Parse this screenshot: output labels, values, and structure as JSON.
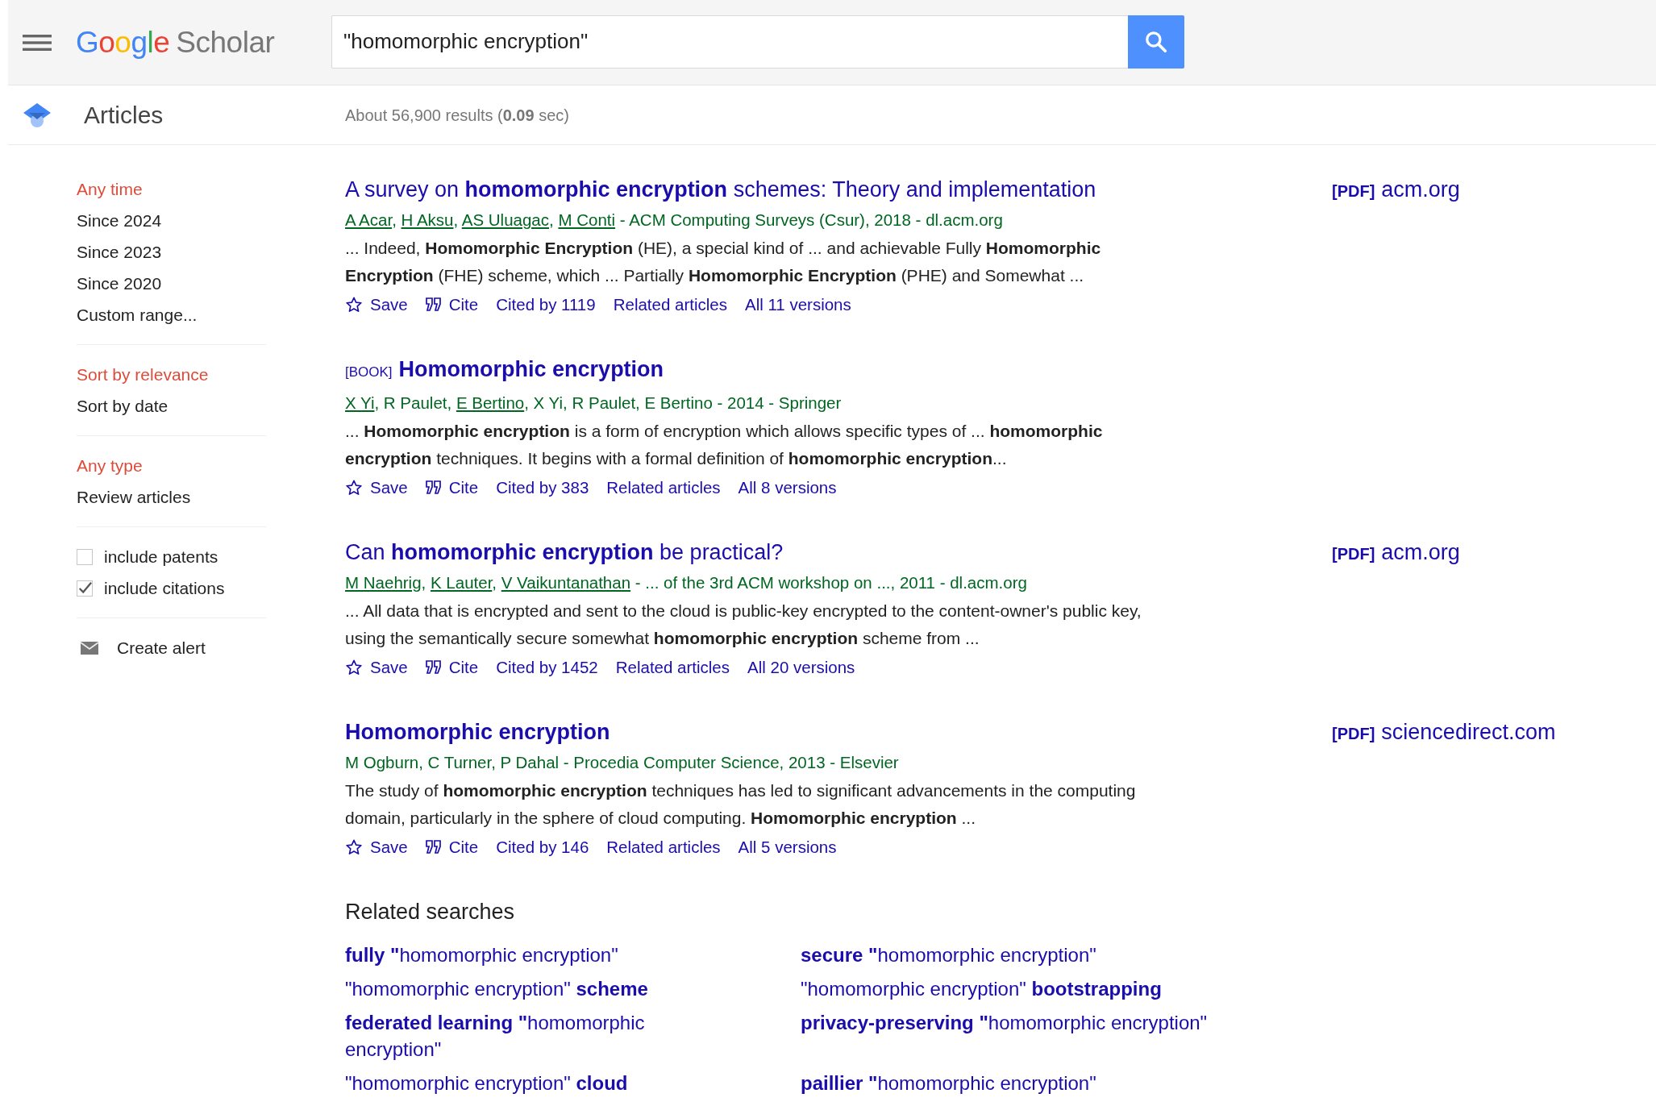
{
  "header": {
    "logo": {
      "brand": "Google",
      "product": "Scholar"
    },
    "search": {
      "value": "\"homomorphic encryption\""
    }
  },
  "subheader": {
    "section": "Articles",
    "summary": "About 56,900 results (**0.09** sec)"
  },
  "sidebar": {
    "groups": [
      {
        "items": [
          {
            "label": "Any time",
            "selected": true
          },
          {
            "label": "Since 2024",
            "selected": false
          },
          {
            "label": "Since 2023",
            "selected": false
          },
          {
            "label": "Since 2020",
            "selected": false
          },
          {
            "label": "Custom range...",
            "selected": false
          }
        ]
      },
      {
        "items": [
          {
            "label": "Sort by relevance",
            "selected": true
          },
          {
            "label": "Sort by date",
            "selected": false
          }
        ]
      },
      {
        "items": [
          {
            "label": "Any type",
            "selected": true
          },
          {
            "label": "Review articles",
            "selected": false
          }
        ]
      }
    ],
    "options": [
      {
        "label": "include patents",
        "checked": false
      },
      {
        "label": "include citations",
        "checked": true
      }
    ],
    "alert": "Create alert"
  },
  "results": [
    {
      "title": "A survey on **homomorphic encryption** schemes: Theory and implementation",
      "byline": [
        {
          "text": "A Acar",
          "link": true
        },
        {
          "text": ", ",
          "link": false
        },
        {
          "text": "H Aksu",
          "link": true
        },
        {
          "text": ", ",
          "link": false
        },
        {
          "text": "AS Uluagac",
          "link": true
        },
        {
          "text": ", ",
          "link": false
        },
        {
          "text": "M Conti",
          "link": true
        },
        {
          "text": " - ACM Computing Surveys (Csur), 2018 - dl.acm.org",
          "link": false
        }
      ],
      "snippet": "... Indeed, **Homomorphic Encryption** (HE), a special kind of ... and achievable Fully **Homomorphic Encryption** (FHE) scheme, which ... Partially **Homomorphic Encryption** (PHE) and Somewhat ...",
      "actions": [
        {
          "kind": "save",
          "label": "Save"
        },
        {
          "kind": "cite",
          "label": "Cite"
        },
        {
          "kind": "link",
          "label": "Cited by 1119"
        },
        {
          "kind": "link",
          "label": "Related articles"
        },
        {
          "kind": "link",
          "label": "All 11 versions"
        }
      ],
      "pdf": {
        "tag": "[PDF]",
        "domain": "acm.org"
      }
    },
    {
      "tag": "[BOOK]",
      "title": "**Homomorphic encryption**",
      "byline": [
        {
          "text": "X Yi",
          "link": true
        },
        {
          "text": ", R Paulet, ",
          "link": false
        },
        {
          "text": "E Bertino",
          "link": true
        },
        {
          "text": ", X Yi, R Paulet, E Bertino - 2014 - Springer",
          "link": false
        }
      ],
      "snippet": "... **Homomorphic encryption** is a form of encryption which allows specific types of ... **homomorphic encryption** techniques. It begins with a formal definition of **homomorphic encryption**...",
      "actions": [
        {
          "kind": "save",
          "label": "Save"
        },
        {
          "kind": "cite",
          "label": "Cite"
        },
        {
          "kind": "link",
          "label": "Cited by 383"
        },
        {
          "kind": "link",
          "label": "Related articles"
        },
        {
          "kind": "link",
          "label": "All 8 versions"
        }
      ]
    },
    {
      "title": "Can **homomorphic encryption** be practical?",
      "byline": [
        {
          "text": "M Naehrig",
          "link": true
        },
        {
          "text": ", ",
          "link": false
        },
        {
          "text": "K Lauter",
          "link": true
        },
        {
          "text": ", ",
          "link": false
        },
        {
          "text": "V Vaikuntanathan",
          "link": true
        },
        {
          "text": " - ... of the 3rd ACM workshop on ..., 2011 - dl.acm.org",
          "link": false
        }
      ],
      "snippet": "... All data that is encrypted and sent to the cloud is public-key encrypted to the content-owner's public key, using the semantically secure somewhat **homomorphic encryption** scheme from ...",
      "actions": [
        {
          "kind": "save",
          "label": "Save"
        },
        {
          "kind": "cite",
          "label": "Cite"
        },
        {
          "kind": "link",
          "label": "Cited by 1452"
        },
        {
          "kind": "link",
          "label": "Related articles"
        },
        {
          "kind": "link",
          "label": "All 20 versions"
        }
      ],
      "pdf": {
        "tag": "[PDF]",
        "domain": "acm.org"
      }
    },
    {
      "title": "**Homomorphic encryption**",
      "byline": [
        {
          "text": "M Ogburn, C Turner, P Dahal - Procedia Computer Science, 2013 - Elsevier",
          "link": false
        }
      ],
      "snippet": "The study of **homomorphic encryption** techniques has led to significant advancements in the computing domain, particularly in the sphere of cloud computing. **Homomorphic encryption** ...",
      "actions": [
        {
          "kind": "save",
          "label": "Save"
        },
        {
          "kind": "cite",
          "label": "Cite"
        },
        {
          "kind": "link",
          "label": "Cited by 146"
        },
        {
          "kind": "link",
          "label": "Related articles"
        },
        {
          "kind": "link",
          "label": "All 5 versions"
        }
      ],
      "pdf": {
        "tag": "[PDF]",
        "domain": "sciencedirect.com"
      }
    }
  ],
  "related": {
    "title": "Related searches",
    "items": [
      "**fully \"**homomorphic encryption\"",
      "**secure \"**homomorphic encryption\"",
      "\"homomorphic encryption\" **scheme**",
      "\"homomorphic encryption\" **bootstrapping**",
      "**federated learning \"**homomorphic encryption\"",
      "**privacy-preserving \"**homomorphic encryption\"",
      "\"homomorphic encryption\" **cloud**",
      "**paillier \"**homomorphic encryption\""
    ]
  }
}
